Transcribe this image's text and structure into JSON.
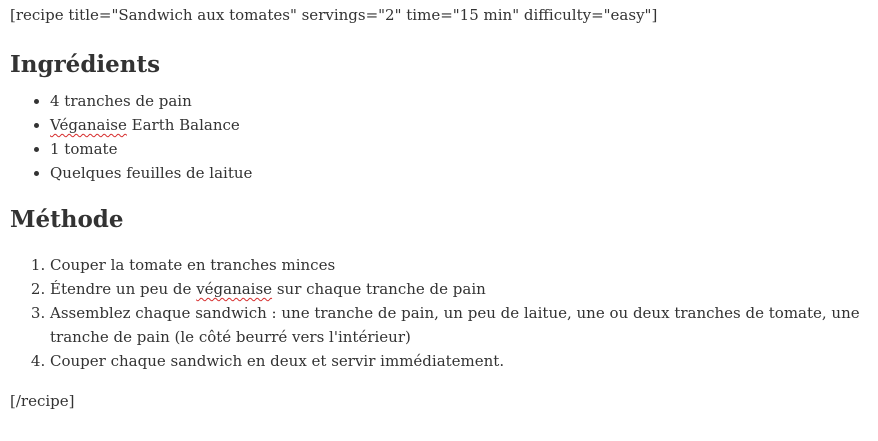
{
  "recipe": {
    "open_tag": "[recipe title=\"Sandwich aux tomates\" servings=\"2\" time=\"15 min\" difficulty=\"easy\"]",
    "close_tag": "[/recipe]"
  },
  "ingredients": {
    "heading": "Ingrédients",
    "items": [
      {
        "text": "4 tranches de pain"
      },
      {
        "misspelled": "Véganaise",
        "after": " Earth Balance"
      },
      {
        "text": "1 tomate"
      },
      {
        "text": "Quelques feuilles de laitue"
      }
    ]
  },
  "method": {
    "heading": "Méthode",
    "steps": [
      {
        "text": "Couper la tomate en tranches minces"
      },
      {
        "before": "Étendre un peu de ",
        "misspelled": "véganaise",
        "after": " sur chaque tranche de pain"
      },
      {
        "text": "Assemblez chaque sandwich : une tranche de pain, un peu de laitue, une ou deux tranches de tomate, une tranche de pain (le côté beurré vers l'intérieur)"
      },
      {
        "text": "Couper chaque sandwich en deux et servir immédiatement."
      }
    ]
  },
  "colors": {
    "text": "#333333",
    "spellcheck_underline": "#d62c2c"
  }
}
